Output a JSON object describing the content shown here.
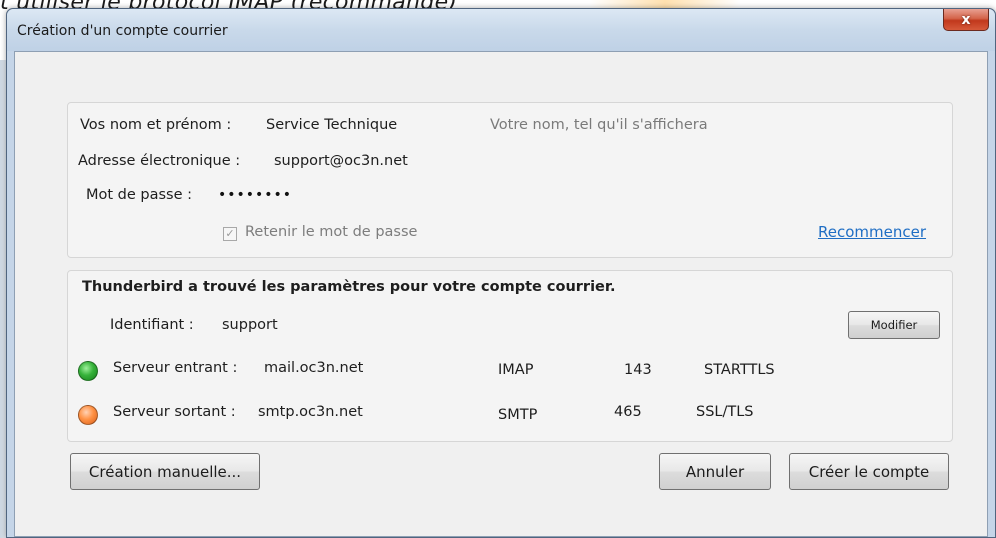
{
  "background": {
    "caption": "t utiliser le protocol IMAP (recommandé)"
  },
  "window": {
    "title": "Création d'un compte courrier",
    "close_label": "x"
  },
  "identity": {
    "name_label": "Vos nom et prénom :",
    "name_value": "Service Technique",
    "name_hint": "Votre nom, tel qu'il s'affichera",
    "email_label": "Adresse électronique :",
    "email_value": "support@oc3n.net",
    "password_label": "Mot de passe :",
    "password_value": "••••••••",
    "remember_label": "Retenir le mot de passe",
    "remember_checked": true,
    "restart_link": "Recommencer"
  },
  "found": {
    "heading": "Thunderbird a trouvé les paramètres pour votre compte courrier.",
    "username_label": "Identifiant :",
    "username_value": "support",
    "modify_button": "Modifier",
    "incoming": {
      "label": "Serveur entrant :",
      "host": "mail.oc3n.net",
      "protocol": "IMAP",
      "port": "143",
      "security": "STARTTLS",
      "status_color": "#2fa634"
    },
    "outgoing": {
      "label": "Serveur sortant :",
      "host": "smtp.oc3n.net",
      "protocol": "SMTP",
      "port": "465",
      "security": "SSL/TLS",
      "status_color": "#ff8a3a"
    }
  },
  "buttons": {
    "manual": "Création manuelle...",
    "cancel": "Annuler",
    "create": "Créer le compte"
  }
}
